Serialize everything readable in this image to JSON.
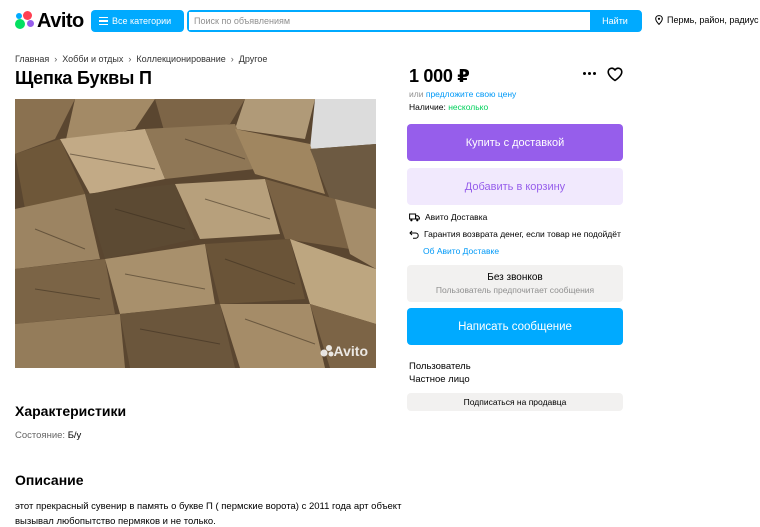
{
  "header": {
    "logo_text": "Avito",
    "categories_label": "Все категории",
    "search_placeholder": "Поиск по объявлениям",
    "search_button": "Найти",
    "location": "Пермь, район, радиус"
  },
  "breadcrumb": [
    "Главная",
    "Хобби и отдых",
    "Коллекционирование",
    "Другое"
  ],
  "listing": {
    "title": "Щепка Буквы П",
    "price": "1 000 ₽",
    "offer_prefix": "или",
    "offer_link": "предложите свою цену",
    "availability_label": "Наличие:",
    "availability_value": "несколько",
    "image_watermark": "Avito"
  },
  "actions": {
    "buy_delivery": "Купить с доставкой",
    "add_to_cart": "Добавить в корзину",
    "delivery": "Авито Доставка",
    "guarantee": "Гарантия возврата денег, если товар не подойдёт",
    "about_delivery": "Об Авито Доставке",
    "no_calls_title": "Без звонков",
    "no_calls_sub": "Пользователь предпочитает сообщения",
    "write_message": "Написать сообщение",
    "subscribe": "Подписаться на продавца"
  },
  "seller": {
    "name": "Пользователь",
    "type": "Частное лицо"
  },
  "characteristics": {
    "heading": "Характеристики",
    "condition_label": "Состояние:",
    "condition_value": "Б/у"
  },
  "description": {
    "heading": "Описание",
    "text": "этот прекрасный сувенир в память о букве П ( пермские ворота) с 2011 года арт объект вызывал любопытство пермяков и не только."
  },
  "colors": {
    "accent_blue": "#00aaff",
    "purple": "#965eeb",
    "light_purple": "#f1e9fd",
    "green": "#02d15c",
    "link_blue": "#0099f7"
  }
}
